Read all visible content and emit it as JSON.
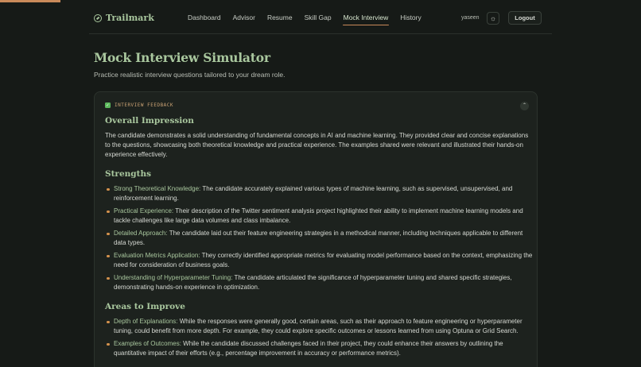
{
  "brand": {
    "name": "Trailmark",
    "icon": "compass-icon"
  },
  "nav": {
    "items": [
      "Dashboard",
      "Advisor",
      "Resume",
      "Skill Gap",
      "Mock Interview",
      "History"
    ],
    "active": "Mock Interview"
  },
  "user": {
    "name": "yaseen"
  },
  "theme_toggle": {
    "icon": "sun-icon"
  },
  "logout_label": "Logout",
  "page": {
    "title": "Mock Interview Simulator",
    "subtitle": "Practice realistic interview questions tailored to your dream role."
  },
  "feedback": {
    "tag": "INTERVIEW FEEDBACK",
    "overall": {
      "heading": "Overall Impression",
      "text": "The candidate demonstrates a solid understanding of fundamental concepts in AI and machine learning. They provided clear and concise explanations to the questions, showcasing both theoretical knowledge and practical experience. The examples shared were relevant and illustrated their hands-on experience effectively."
    },
    "strengths": {
      "heading": "Strengths",
      "items": [
        {
          "term": "Strong Theoretical Knowledge:",
          "text": " The candidate accurately explained various types of machine learning, such as supervised, unsupervised, and reinforcement learning."
        },
        {
          "term": "Practical Experience:",
          "text": " Their description of the Twitter sentiment analysis project highlighted their ability to implement machine learning models and tackle challenges like large data volumes and class imbalance."
        },
        {
          "term": "Detailed Approach:",
          "text": " The candidate laid out their feature engineering strategies in a methodical manner, including techniques applicable to different data types."
        },
        {
          "term": "Evaluation Metrics Application:",
          "text": " They correctly identified appropriate metrics for evaluating model performance based on the context, emphasizing the need for consideration of business goals."
        },
        {
          "term": "Understanding of Hyperparameter Tuning:",
          "text": " The candidate articulated the significance of hyperparameter tuning and shared specific strategies, demonstrating hands-on experience in optimization."
        }
      ]
    },
    "improve": {
      "heading": "Areas to Improve",
      "items": [
        {
          "term": "Depth of Explanations:",
          "text": " While the responses were generally good, certain areas, such as their approach to feature engineering or hyperparameter tuning, could benefit from more depth. For example, they could explore specific outcomes or lessons learned from using Optuna or Grid Search."
        },
        {
          "term": "Examples of Outcomes:",
          "text": " While the candidate discussed challenges faced in their project, they could enhance their answers by outlining the quantitative impact of their efforts (e.g., percentage improvement in accuracy or performance metrics)."
        }
      ]
    }
  },
  "colors": {
    "accent": "#a9c79e",
    "highlight": "#c98a5a",
    "background": "#161a17"
  }
}
